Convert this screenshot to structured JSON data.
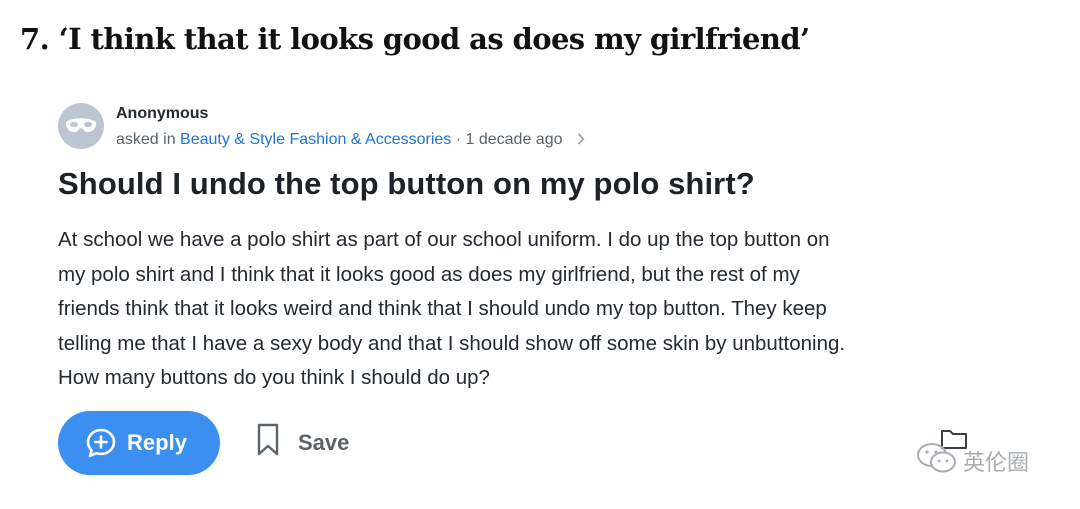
{
  "article": {
    "headline": "7. ‘I think that it looks good as does my girlfriend’"
  },
  "question": {
    "author": "Anonymous",
    "asked_in_prefix": "asked in ",
    "categories": "Beauty & Style Fashion & Accessories",
    "separator": " · ",
    "time_ago": "1 decade ago",
    "title": "Should I undo the top button on my polo shirt?",
    "body_lines": [
      "At school we have a polo shirt as part of our school uniform. I do up the top button on",
      "my polo shirt and I think that it looks good as does my girlfriend, but the rest of my",
      "friends think that it looks weird and think that I should undo my top button. They keep",
      "telling me that I have a sexy body and that I should show off some skin by unbuttoning.",
      "How many buttons do you think I should do up?"
    ]
  },
  "actions": {
    "reply_label": "Reply",
    "save_label": "Save"
  },
  "watermark": {
    "text": "英伦圈"
  },
  "icons": {
    "avatar": "masked-avatar-icon",
    "chevron": "chevron-right-icon",
    "reply": "plus-chat-bubble-icon",
    "save": "bookmark-icon",
    "folder": "folder-icon",
    "wechat": "wechat-icon"
  },
  "colors": {
    "reply_button": "#3b8ff0",
    "category_link": "#1e74d8",
    "avatar_bg": "#bcc6d3"
  }
}
